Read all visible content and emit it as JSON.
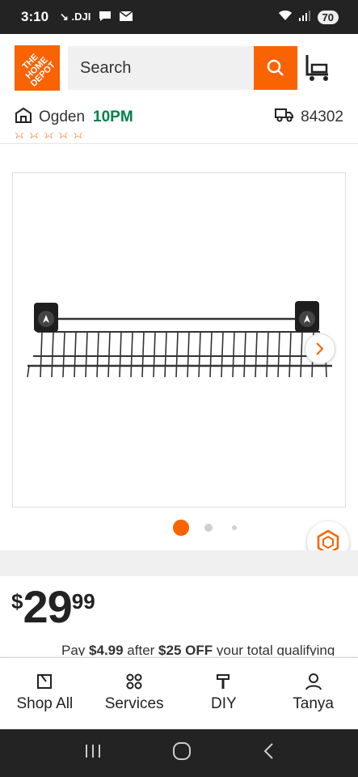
{
  "status_bar": {
    "time": "3:10",
    "icons_left": [
      "↘ .DJI",
      "message-icon",
      "mail-icon"
    ],
    "battery": "70"
  },
  "header": {
    "logo_text": "THE\nHOME\nDEPOT",
    "search_placeholder": "Search",
    "brand_color": "#f96302"
  },
  "location_bar": {
    "store": "Ogden",
    "hours": "10PM",
    "zip": "84302"
  },
  "gallery": {
    "image_alt": "Wire shelf",
    "dots": 3,
    "active_dot": 1
  },
  "product": {
    "currency": "$",
    "price_dollars": "29",
    "price_cents": "99"
  },
  "promo": {
    "pre": "Pay ",
    "amount": "$4.99",
    "mid": " after ",
    "off": "$25 OFF",
    "post": " your total qualifying"
  },
  "bottom_nav": [
    {
      "label": "Shop All",
      "icon": "shop-all-icon"
    },
    {
      "label": "Services",
      "icon": "services-icon"
    },
    {
      "label": "DIY",
      "icon": "diy-icon"
    },
    {
      "label": "Tanya",
      "icon": "user-icon"
    }
  ]
}
